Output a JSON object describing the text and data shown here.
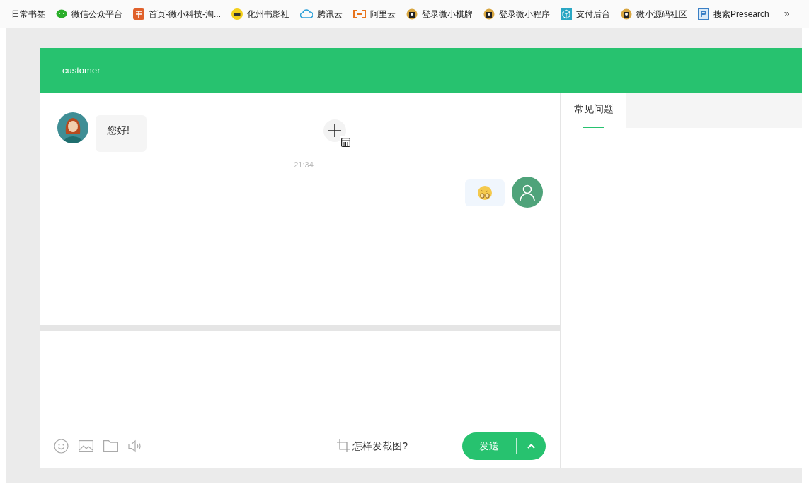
{
  "bookmarks": [
    {
      "label": "日常书签",
      "kind": "plain"
    },
    {
      "label": "微信公众平台",
      "kind": "chat"
    },
    {
      "label": "首页-微小科技-淘...",
      "kind": "shop"
    },
    {
      "label": "化州书影社",
      "kind": "ticket"
    },
    {
      "label": "腾讯云",
      "kind": "cloud"
    },
    {
      "label": "阿里云",
      "kind": "bracket"
    },
    {
      "label": "登录微小棋牌",
      "kind": "mascot"
    },
    {
      "label": "登录微小程序",
      "kind": "mascot"
    },
    {
      "label": "支付后台",
      "kind": "cube"
    },
    {
      "label": "微小源码社区",
      "kind": "mascot"
    },
    {
      "label": "搜索Presearch",
      "kind": "letter"
    }
  ],
  "bookmarks_more": "»",
  "header": {
    "title": "customer"
  },
  "messages": [
    {
      "kind": "received_text",
      "text": "您好!"
    },
    {
      "kind": "time",
      "text": "21:34"
    },
    {
      "kind": "sent_emoji"
    }
  ],
  "composer": {
    "hint": "怎样发截图?",
    "send": "发送"
  },
  "side_tabs": [
    {
      "label": "常见问题",
      "selected": true
    }
  ]
}
